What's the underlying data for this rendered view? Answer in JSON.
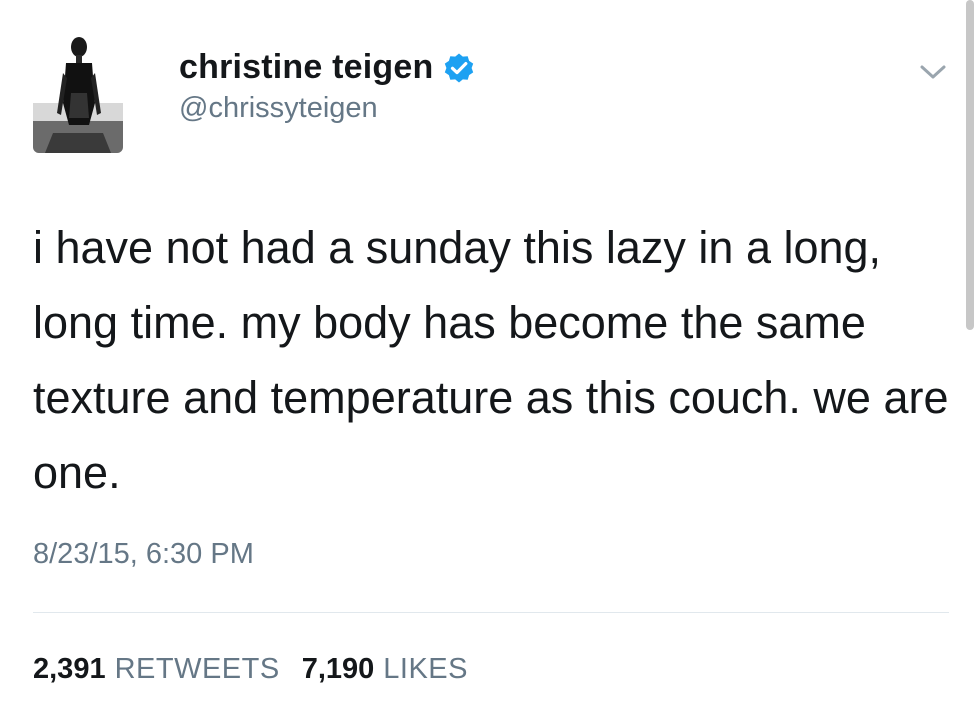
{
  "author": {
    "display_name": "christine teigen",
    "handle": "@chrissyteigen",
    "verified": true,
    "avatar_icon": "profile-photo",
    "verified_icon": "verified-badge-icon"
  },
  "menu": {
    "icon": "chevron-down-icon"
  },
  "tweet": {
    "text": "i have not had a sunday this lazy in a long, long time. my body has become the same texture and temperature as this couch. we are one.",
    "timestamp": "8/23/15, 6:30 PM"
  },
  "stats": {
    "retweets_count": "2,391",
    "retweets_label": "RETWEETS",
    "likes_count": "7,190",
    "likes_label": "LIKES"
  },
  "colors": {
    "text": "#14171a",
    "secondary": "#657786",
    "verified_blue": "#1da1f2",
    "divider": "#e1e8ed"
  }
}
